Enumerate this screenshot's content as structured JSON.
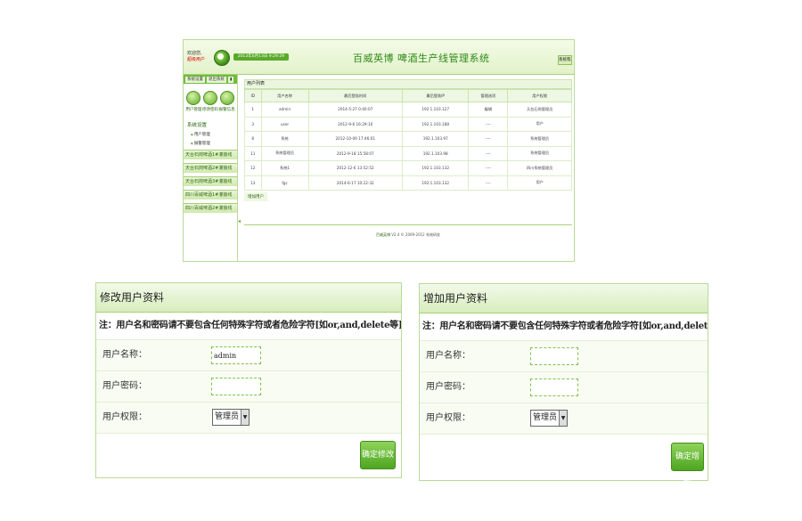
{
  "screenshot": {
    "welcome_line1": "欢迎您,",
    "welcome_line2": "超级用户",
    "date_text": "2013年6月13日  9:29:29",
    "system_title": "百威英博  啤酒生产线管理系统",
    "top_right_text": "系统帮助",
    "sidebar": {
      "tabs": [
        "系统设置",
        "退出系统",
        "▮"
      ],
      "icons": [
        {
          "label": "用户管理",
          "icon": "user-icon"
        },
        {
          "label": "修改密码",
          "icon": "key-icon"
        },
        {
          "label": "报警信息",
          "icon": "alarm-icon"
        }
      ],
      "section": "系统设置",
      "sub_items": [
        "用户管理",
        "报警管理"
      ],
      "lines": [
        "天台石岗啤酒1#灌装线",
        "天台石岗啤酒2#灌装线",
        "天台石岗啤酒3#灌装线",
        "四川百威啤酒1#灌装线",
        "四川百威啤酒2#灌装线"
      ]
    },
    "content_header": "用户列表",
    "table": {
      "headers": [
        "ID",
        "用户名称",
        "最后登陆时间",
        "最后登陆IP",
        "管理选项",
        "用户权限"
      ],
      "rows": [
        [
          "1",
          "admin",
          "2014-5-27 0:40:07",
          "192.1.103.127",
          "编辑",
          "天台石岗管理员"
        ],
        [
          "3",
          "user",
          "2012-9-6 16:29:10",
          "192.1.103.188",
          "----",
          "用户"
        ],
        [
          "8",
          "系统",
          "2012-10-09 17:46:01",
          "192.1.103.97",
          "----",
          "系统管理员"
        ],
        [
          "11",
          "系统管理员",
          "2012-9-18 15:58:07",
          "192.1.103.98",
          "----",
          "系统管理员"
        ],
        [
          "12",
          "系统1",
          "2012-12-6 13:52:52",
          "192.1.103.132",
          "----",
          "四川系统管理员"
        ],
        [
          "13",
          "fgc",
          "2014-6-17 10:22:32",
          "192.1.103.132",
          "----",
          "用户"
        ]
      ]
    },
    "add_user_link": "增加用户",
    "footer_brand": "百威英博",
    "footer_rest": " V2.4 © 2009-2012 系统研发"
  },
  "edit_form": {
    "title": "修改用户资料",
    "notice": "注：用户名和密码请不要包含任何特殊字符或者危险字符[如or,and,delete等]",
    "username_label": "用户名称：",
    "username_value": "admin",
    "password_label": "用户密码：",
    "password_value": "",
    "role_label": "用户权限：",
    "role_value": "管理员",
    "submit": "确定修改"
  },
  "add_form": {
    "title": "增加用户资料",
    "notice": "注：用户名和密码请不要包含任何特殊字符或者危险字符[如or,and,delete等]",
    "username_label": "用户名称：",
    "username_value": "",
    "password_label": "用户密码：",
    "password_value": "",
    "role_label": "用户权限：",
    "role_value": "管理员",
    "submit": "确定增加"
  },
  "colors": {
    "accent": "#5aaa2a",
    "title_green": "#2e8a18",
    "border": "#b9d99a"
  }
}
